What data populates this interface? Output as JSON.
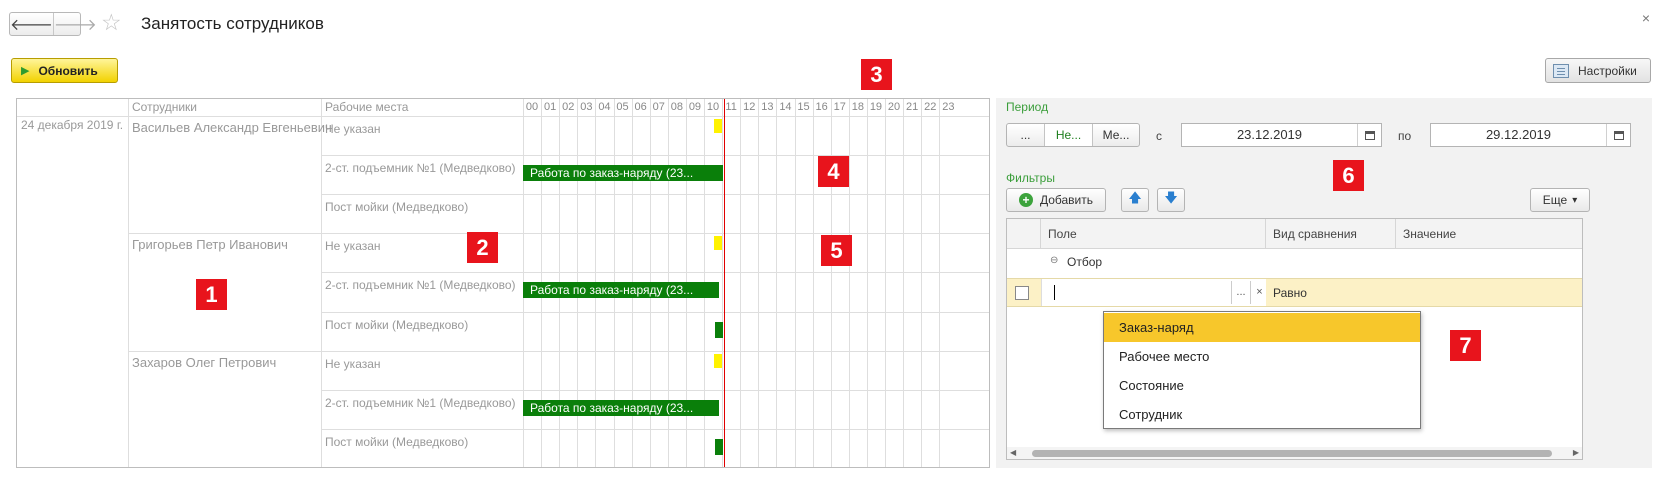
{
  "header": {
    "title": "Занятость сотрудников",
    "back_icon": "🡐",
    "forward_icon": "🡒",
    "star_icon": "☆",
    "close_icon": "×"
  },
  "toolbar": {
    "refresh_label": "Обновить",
    "settings_label": "Настройки"
  },
  "markers": [
    "1",
    "2",
    "3",
    "4",
    "5",
    "6",
    "7"
  ],
  "gantt": {
    "columns": {
      "employees": "Сотрудники",
      "workplaces": "Рабочие места"
    },
    "hours": [
      "00",
      "01",
      "02",
      "03",
      "04",
      "05",
      "06",
      "07",
      "08",
      "09",
      "10",
      "11",
      "12",
      "13",
      "14",
      "15",
      "16",
      "17",
      "18",
      "19",
      "20",
      "21",
      "22",
      "23"
    ],
    "date_label": "24 декабря 2019 г.",
    "employees": [
      {
        "name": "Васильев Александр Евгеньевич",
        "places": [
          "Не указан",
          "2-ст. подъемник №1 (Медведково)",
          "Пост мойки (Медведково)"
        ]
      },
      {
        "name": "Григорьев Петр Иванович",
        "places": [
          "Не указан",
          "2-ст. подъемник №1 (Медведково)",
          "Пост мойки (Медведково)"
        ]
      },
      {
        "name": "Захаров Олег Петрович",
        "places": [
          "Не указан",
          "2-ст. подъемник №1 (Медведково)",
          "Пост мойки (Медведково)"
        ]
      }
    ],
    "bar_label": "Работа по заказ-наряду (23...",
    "colors": {
      "work": "#0a7f0a",
      "idle": "#fff200",
      "now": "#e00000"
    }
  },
  "panel": {
    "period_label": "Период",
    "seg_items": [
      "...",
      "Не...",
      "Ме..."
    ],
    "from_label": "с",
    "to_label": "по",
    "date_from": "23.12.2019",
    "date_to": "29.12.2019",
    "filters_label": "Фильтры",
    "add_label": "Добавить",
    "more_label": "Еще",
    "more_caret": "▾",
    "table": {
      "col_field": "Поле",
      "col_compare": "Вид сравнения",
      "col_value": "Значение",
      "group_label": "Отбор",
      "row_compare": "Равно",
      "dots": "...",
      "clear": "×"
    },
    "dropdown": [
      "Заказ-наряд",
      "Рабочее место",
      "Состояние",
      "Сотрудник"
    ]
  }
}
